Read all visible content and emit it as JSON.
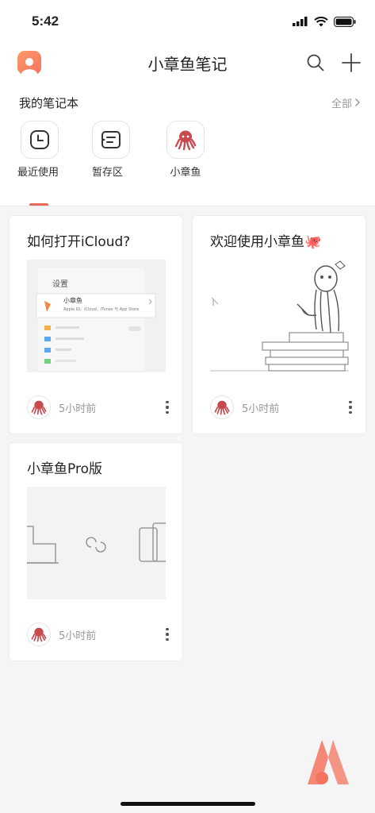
{
  "status_bar": {
    "time": "5:42"
  },
  "header": {
    "title": "小章鱼笔记"
  },
  "notebooks": {
    "title": "我的笔记本",
    "all_label": "全部",
    "items": [
      {
        "label": "最近使用",
        "icon": "clock-icon"
      },
      {
        "label": "暂存区",
        "icon": "draft-icon"
      },
      {
        "label": "小章鱼",
        "icon": "octopus-icon"
      }
    ]
  },
  "notes": [
    {
      "title": "如何打开iCloud?",
      "time": "5小时前",
      "thumb": {
        "settings_title": "设置",
        "app_name": "小章鱼",
        "app_desc": "Apple ID、iCloud、iTunes 与 App Store"
      }
    },
    {
      "title": "欢迎使用小章鱼🐙",
      "time": "5小时前"
    },
    {
      "title": "小章鱼Pro版",
      "time": "5小时前"
    }
  ],
  "colors": {
    "accent": "#e86a5b",
    "brand_orange": "#f3735e"
  }
}
